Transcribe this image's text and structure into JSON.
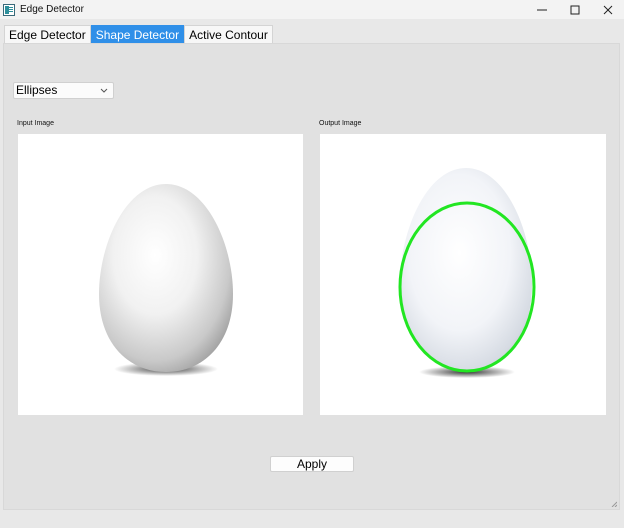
{
  "window": {
    "title": "Edge Detector",
    "controls": [
      "minimize-icon",
      "maximize-icon",
      "close-icon"
    ]
  },
  "tabs": [
    {
      "label": "Edge Detector",
      "active": false
    },
    {
      "label": "Shape Detector",
      "active": true
    },
    {
      "label": "Active Contour",
      "active": false
    }
  ],
  "shape_select": {
    "value": "Ellipses"
  },
  "input_image": {
    "label": "Input Image"
  },
  "output_image": {
    "label": "Output Image",
    "detection_color": "#22e622"
  },
  "apply_button": {
    "label": "Apply"
  },
  "colors": {
    "accent": "#2f8fe8",
    "panel": "#e1e1e1"
  }
}
